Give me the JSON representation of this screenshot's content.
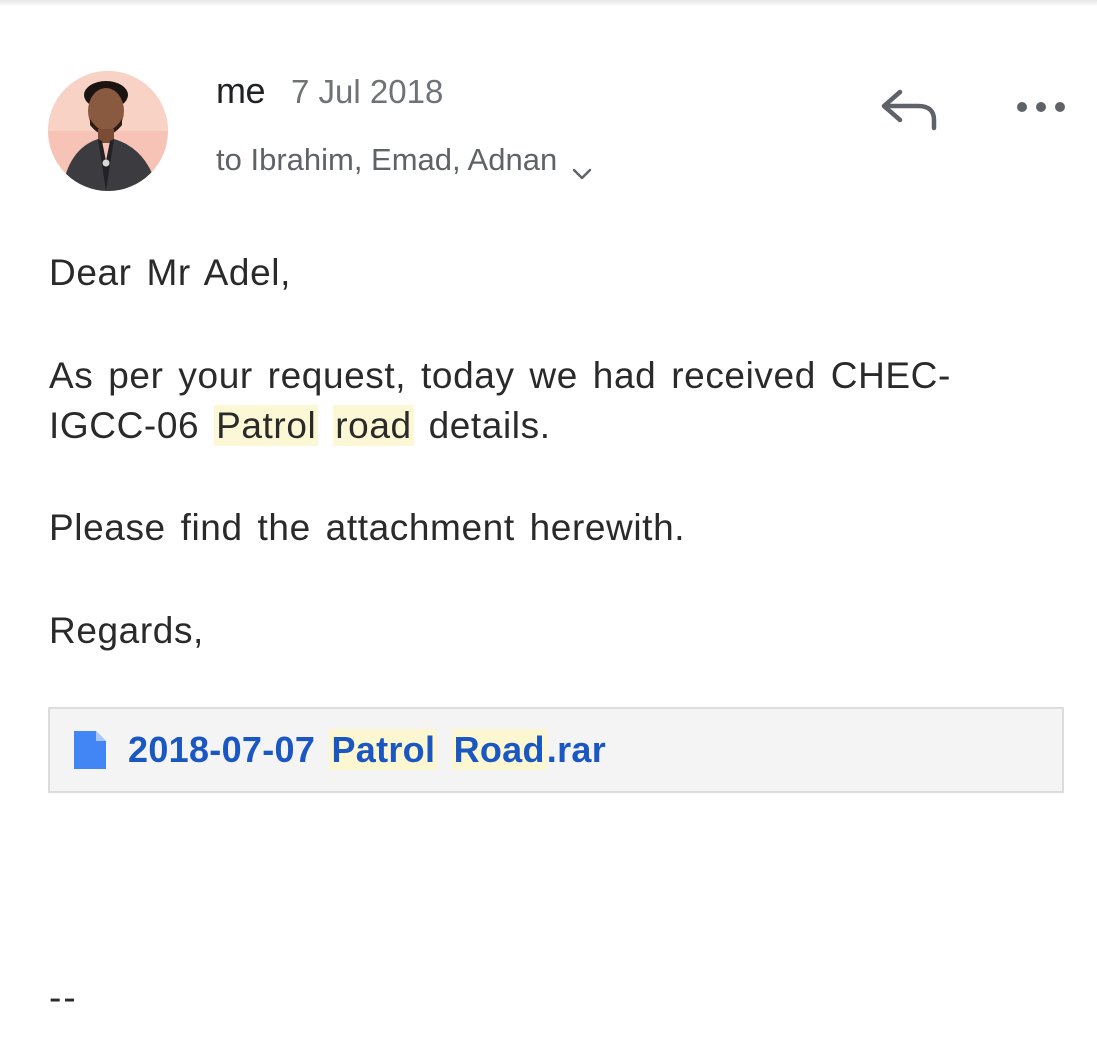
{
  "sender": {
    "name": "me",
    "date": "7 Jul 2018",
    "recipients": "to Ibrahim, Emad, Adnan"
  },
  "icons": {
    "reply": "reply-icon",
    "more": "more-horizontal-icon",
    "chevron": "chevron-down-icon",
    "file": "file-icon"
  },
  "body": {
    "greeting": "Dear Mr Adel,",
    "request_before": "As per your request, today we had received CHEC-IGCC-06 ",
    "request_highlight_1": "Patrol",
    "request_highlight_2": "road",
    "request_after": " details.",
    "find": "Please find the attachment herewith.",
    "regards": "Regards,",
    "signature_separator": "--"
  },
  "attachment": {
    "name_prefix": "2018-07-07 ",
    "name_highlight_1": "Patrol",
    "name_highlight_2": "Road",
    "name_suffix": ".rar"
  },
  "colors": {
    "highlight": "#fcf8d6",
    "link": "#1a57c2",
    "file_icon": "#4285f4",
    "muted_text": "#5f6368"
  }
}
